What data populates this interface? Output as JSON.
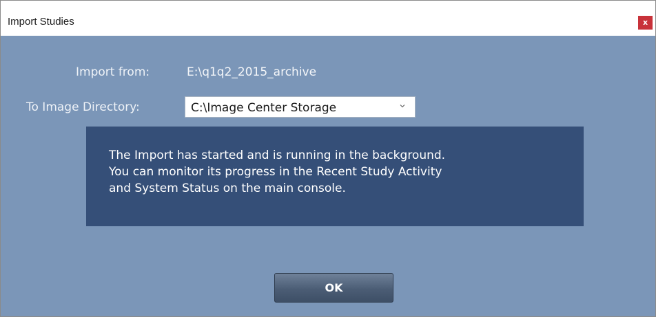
{
  "window": {
    "title": "Import Studies",
    "close_label": "x"
  },
  "form": {
    "import_from_label": "Import from:",
    "import_from_value": "E:\\q1q2_2015_archive",
    "image_directory_label": "To Image Directory:",
    "image_directory_value": "C:\\Image Center Storage"
  },
  "message": {
    "lines": [
      "The Import has started and is running in the background.",
      "You can monitor its progress in the Recent Study Activity",
      "and System Status on the main console."
    ]
  },
  "buttons": {
    "ok_label": "OK"
  },
  "icons": {
    "close": "close-icon",
    "dropdown": "chevron-down-icon"
  },
  "colors": {
    "dialog_background": "#7b96b8",
    "message_background": "#354f78",
    "close_button": "#c8323a"
  }
}
